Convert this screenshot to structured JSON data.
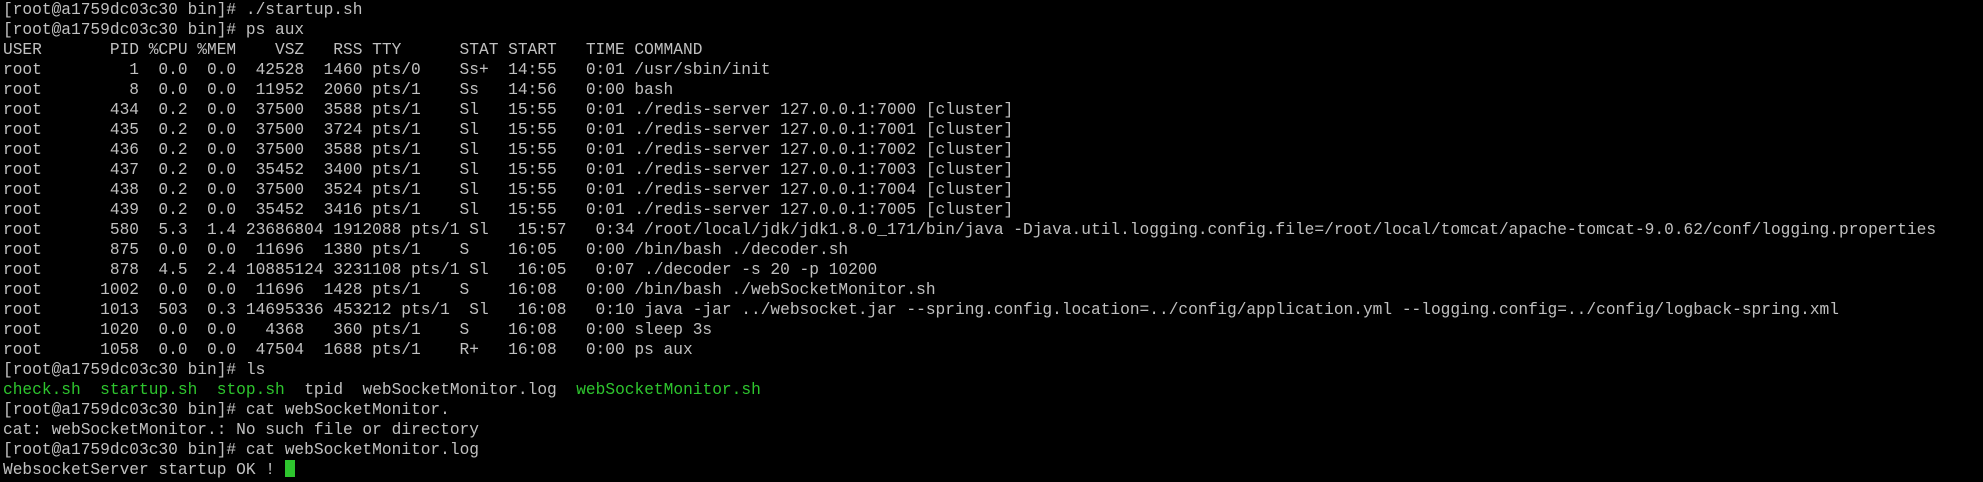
{
  "terminal": {
    "lines": [
      {
        "type": "cmd",
        "prompt": "[root@a1759dc03c30 bin]# ",
        "command": "./startup.sh"
      },
      {
        "type": "cmd",
        "prompt": "[root@a1759dc03c30 bin]# ",
        "command": "ps aux"
      },
      {
        "type": "out",
        "text": "USER       PID %CPU %MEM    VSZ   RSS TTY      STAT START   TIME COMMAND"
      },
      {
        "type": "out",
        "text": "root         1  0.0  0.0  42528  1460 pts/0    Ss+  14:55   0:01 /usr/sbin/init"
      },
      {
        "type": "out",
        "text": "root         8  0.0  0.0  11952  2060 pts/1    Ss   14:56   0:00 bash"
      },
      {
        "type": "out",
        "text": "root       434  0.2  0.0  37500  3588 pts/1    Sl   15:55   0:01 ./redis-server 127.0.0.1:7000 [cluster]"
      },
      {
        "type": "out",
        "text": "root       435  0.2  0.0  37500  3724 pts/1    Sl   15:55   0:01 ./redis-server 127.0.0.1:7001 [cluster]"
      },
      {
        "type": "out",
        "text": "root       436  0.2  0.0  37500  3588 pts/1    Sl   15:55   0:01 ./redis-server 127.0.0.1:7002 [cluster]"
      },
      {
        "type": "out",
        "text": "root       437  0.2  0.0  35452  3400 pts/1    Sl   15:55   0:01 ./redis-server 127.0.0.1:7003 [cluster]"
      },
      {
        "type": "out",
        "text": "root       438  0.2  0.0  37500  3524 pts/1    Sl   15:55   0:01 ./redis-server 127.0.0.1:7004 [cluster]"
      },
      {
        "type": "out",
        "text": "root       439  0.2  0.0  35452  3416 pts/1    Sl   15:55   0:01 ./redis-server 127.0.0.1:7005 [cluster]"
      },
      {
        "type": "out",
        "text": "root       580  5.3  1.4 23686804 1912088 pts/1 Sl   15:57   0:34 /root/local/jdk/jdk1.8.0_171/bin/java -Djava.util.logging.config.file=/root/local/tomcat/apache-tomcat-9.0.62/conf/logging.properties"
      },
      {
        "type": "out",
        "text": "root       875  0.0  0.0  11696  1380 pts/1    S    16:05   0:00 /bin/bash ./decoder.sh"
      },
      {
        "type": "out",
        "text": "root       878  4.5  2.4 10885124 3231108 pts/1 Sl   16:05   0:07 ./decoder -s 20 -p 10200"
      },
      {
        "type": "out",
        "text": "root      1002  0.0  0.0  11696  1428 pts/1    S    16:08   0:00 /bin/bash ./webSocketMonitor.sh"
      },
      {
        "type": "out",
        "text": "root      1013  503  0.3 14695336 453212 pts/1  Sl   16:08   0:10 java -jar ../websocket.jar --spring.config.location=../config/application.yml --logging.config=../config/logback-spring.xml"
      },
      {
        "type": "out",
        "text": "root      1020  0.0  0.0   4368   360 pts/1    S    16:08   0:00 sleep 3s"
      },
      {
        "type": "out",
        "text": "root      1058  0.0  0.0  47504  1688 pts/1    R+   16:08   0:00 ps aux"
      },
      {
        "type": "cmd",
        "prompt": "[root@a1759dc03c30 bin]# ",
        "command": "ls"
      },
      {
        "type": "ls",
        "files": [
          {
            "name": "check.sh",
            "kind": "exe"
          },
          {
            "name": "startup.sh",
            "kind": "exe"
          },
          {
            "name": "stop.sh",
            "kind": "exe"
          },
          {
            "name": "tpid",
            "kind": "file"
          },
          {
            "name": "webSocketMonitor.log",
            "kind": "file"
          },
          {
            "name": "webSocketMonitor.sh",
            "kind": "exe"
          }
        ]
      },
      {
        "type": "cmd",
        "prompt": "[root@a1759dc03c30 bin]# ",
        "command": "cat webSocketMonitor."
      },
      {
        "type": "out",
        "text": "cat: webSocketMonitor.: No such file or directory"
      },
      {
        "type": "cmd",
        "prompt": "[root@a1759dc03c30 bin]# ",
        "command": "cat webSocketMonitor.log"
      },
      {
        "type": "cursor-line",
        "text": "WebsocketServer startup OK !"
      }
    ]
  },
  "colors": {
    "background": "#000000",
    "foreground": "#c0c0c0",
    "executable": "#2ec52e",
    "cursor": "#2ec52e"
  }
}
